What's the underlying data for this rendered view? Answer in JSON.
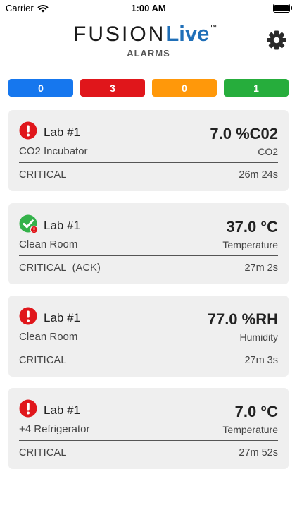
{
  "status_bar": {
    "carrier": "Carrier",
    "time": "1:00 AM"
  },
  "header": {
    "logo_fusion": "FUSION",
    "logo_live": "Live",
    "logo_tm": "™",
    "subtitle": "ALARMS",
    "settings_icon": "gear-icon"
  },
  "counts": [
    {
      "value": "0",
      "color": "#1677ee"
    },
    {
      "value": "3",
      "color": "#e0161b"
    },
    {
      "value": "0",
      "color": "#ff980a"
    },
    {
      "value": "1",
      "color": "#26ad3c"
    }
  ],
  "alarms": [
    {
      "status_icon": "alert-red-icon",
      "location": "Lab #1",
      "reading": "7.0 %C02",
      "device": "CO2 Incubator",
      "sensor_type": "CO2",
      "state": "CRITICAL",
      "elapsed": "26m 24s"
    },
    {
      "status_icon": "check-green-icon",
      "location": "Lab #1",
      "reading": "37.0 °C",
      "device": "Clean Room",
      "sensor_type": "Temperature",
      "state": "CRITICAL  (ACK)",
      "elapsed": "27m 2s"
    },
    {
      "status_icon": "alert-red-icon",
      "location": "Lab #1",
      "reading": "77.0 %RH",
      "device": "Clean Room",
      "sensor_type": "Humidity",
      "state": "CRITICAL",
      "elapsed": "27m 3s"
    },
    {
      "status_icon": "alert-red-icon",
      "location": "Lab #1",
      "reading": "7.0 °C",
      "device": "+4 Refrigerator",
      "sensor_type": "Temperature",
      "state": "CRITICAL",
      "elapsed": "27m 52s"
    }
  ]
}
